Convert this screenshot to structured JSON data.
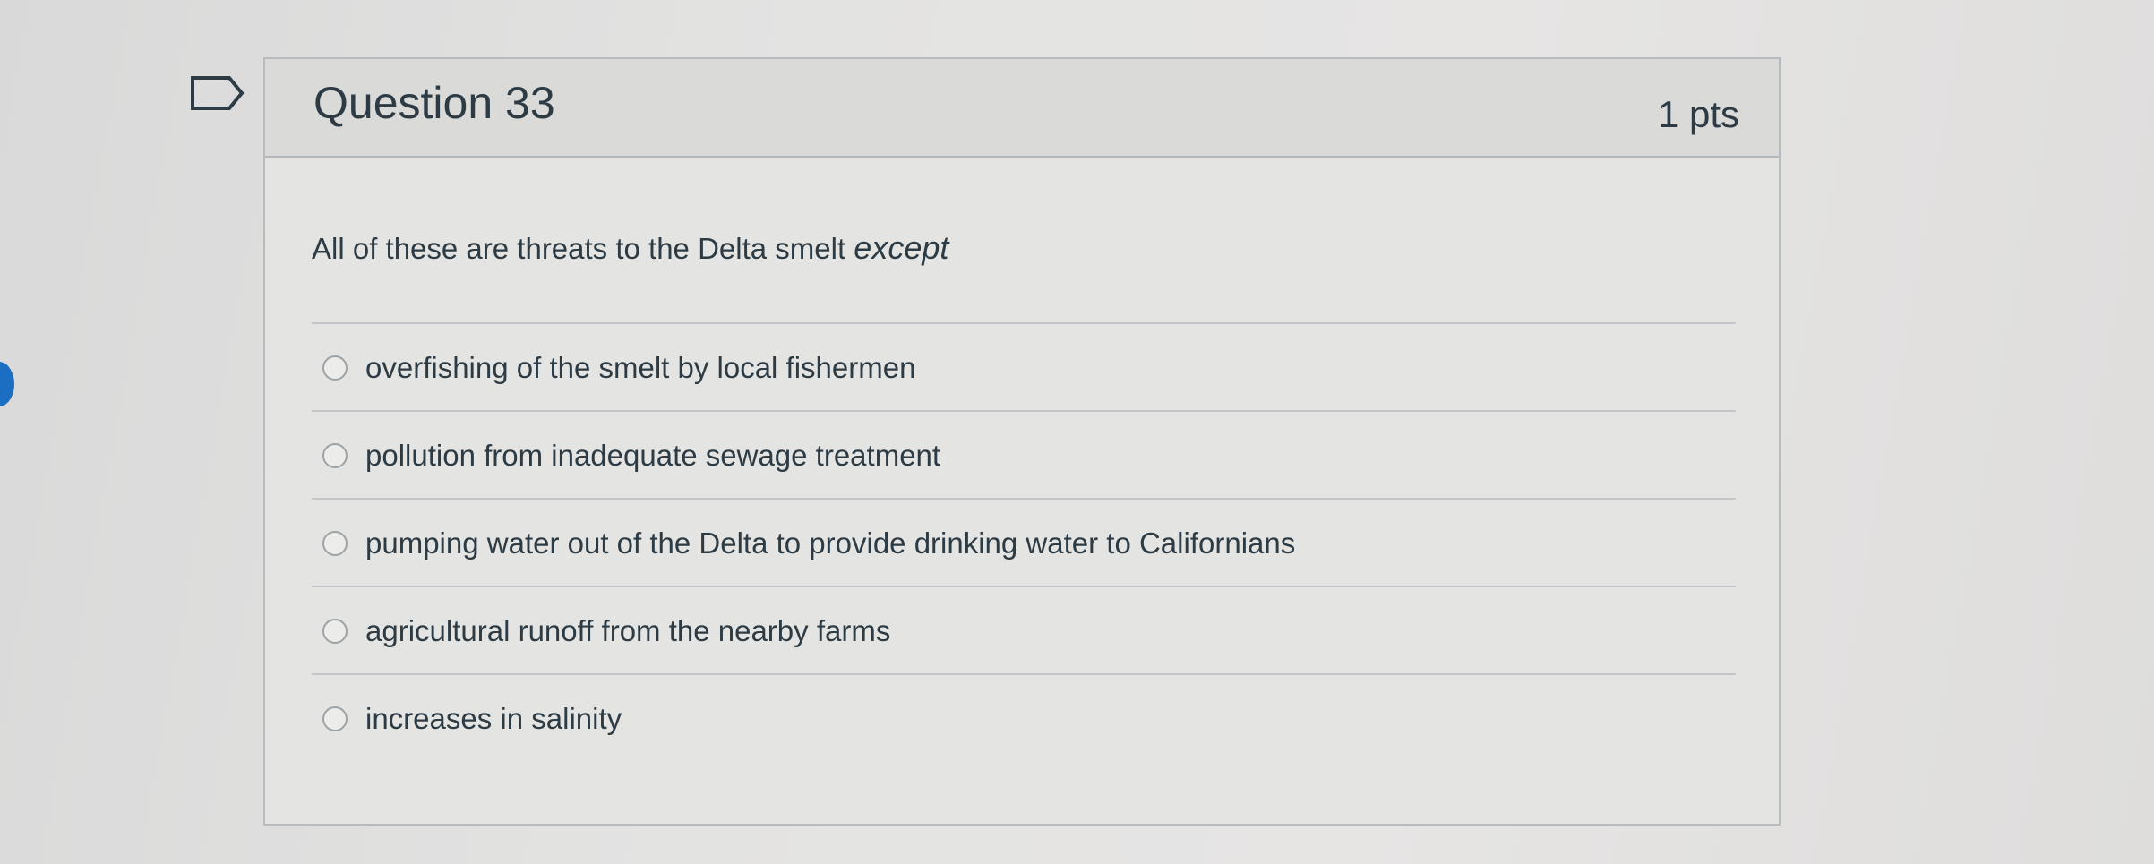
{
  "question": {
    "title": "Question 33",
    "points": "1 pts",
    "text": "All of these are threats to the Delta smelt ",
    "text_emphasis": "except"
  },
  "answers": [
    {
      "label": "overfishing of the smelt by local fishermen"
    },
    {
      "label": "pollution from inadequate sewage treatment"
    },
    {
      "label": "pumping water out of the Delta to provide drinking water to Californians"
    },
    {
      "label": "agricultural runoff from the nearby farms"
    },
    {
      "label": "increases in salinity"
    }
  ],
  "icons": {
    "flag": "flag-outline-icon",
    "radio": "radio-unchecked-icon"
  },
  "colors": {
    "text": "#2d3b45",
    "border": "#b9bcbe",
    "header_bg": "#dadad9",
    "accent": "#1b6ec2"
  }
}
